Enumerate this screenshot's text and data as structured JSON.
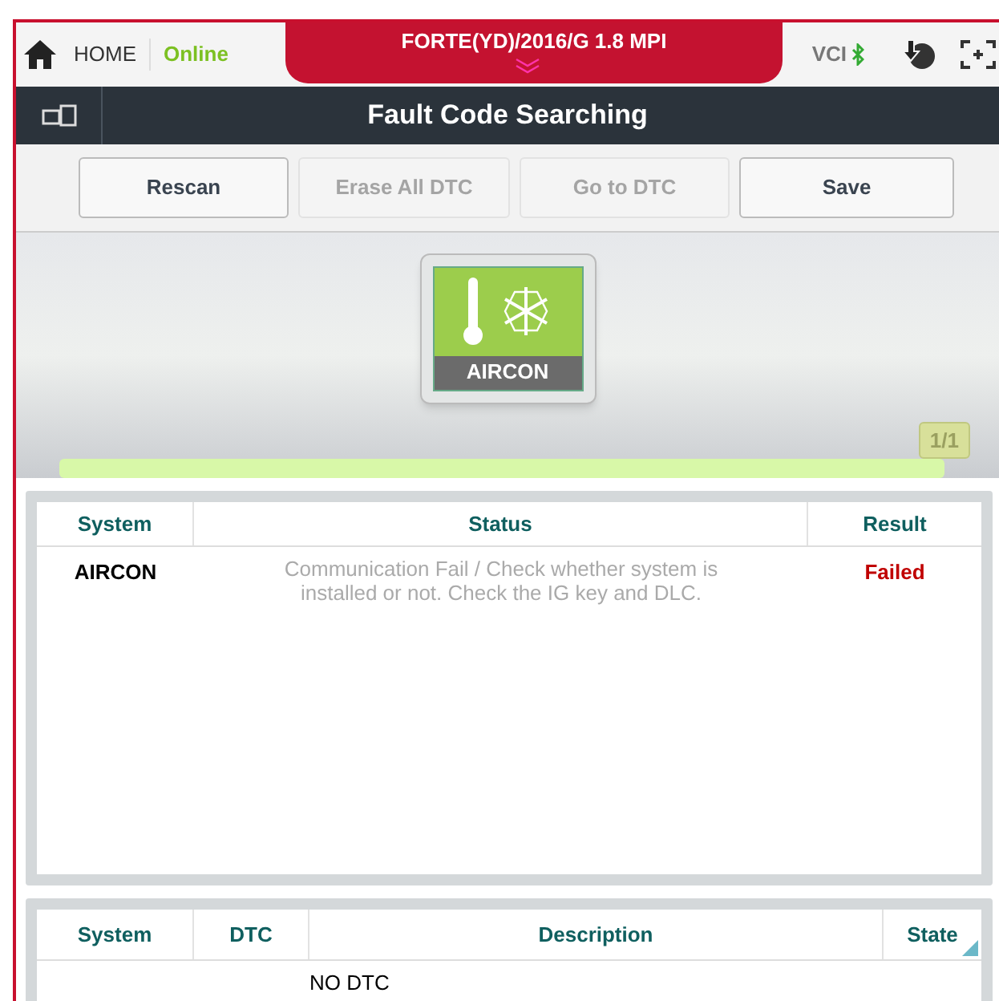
{
  "top_bar": {
    "home": "HOME",
    "connection": "Online",
    "vehicle": "FORTE(YD)/2016/G 1.8 MPI",
    "vci": "VCI"
  },
  "title_bar": {
    "title": "Fault Code Searching"
  },
  "buttons": [
    {
      "label": "Rescan",
      "disabled": false
    },
    {
      "label": "Erase All DTC",
      "disabled": true
    },
    {
      "label": "Go to DTC",
      "disabled": true
    },
    {
      "label": "Save",
      "disabled": false
    }
  ],
  "system_tile": {
    "label": "AIRCON"
  },
  "progress": {
    "level": 1.0,
    "reading": "1/1"
  },
  "results_table": {
    "columns": [
      "System",
      "Status",
      "Result"
    ],
    "rows": [
      {
        "system": "AIRCON",
        "status": "Communication Fail / Check whether system is installed or not. Check the IG key and DLC.",
        "result": "Failed"
      }
    ]
  },
  "dtc_table": {
    "columns": [
      "System",
      "DTC",
      "Description",
      "State"
    ],
    "rows": [
      {
        "description": "NO DTC"
      }
    ]
  }
}
